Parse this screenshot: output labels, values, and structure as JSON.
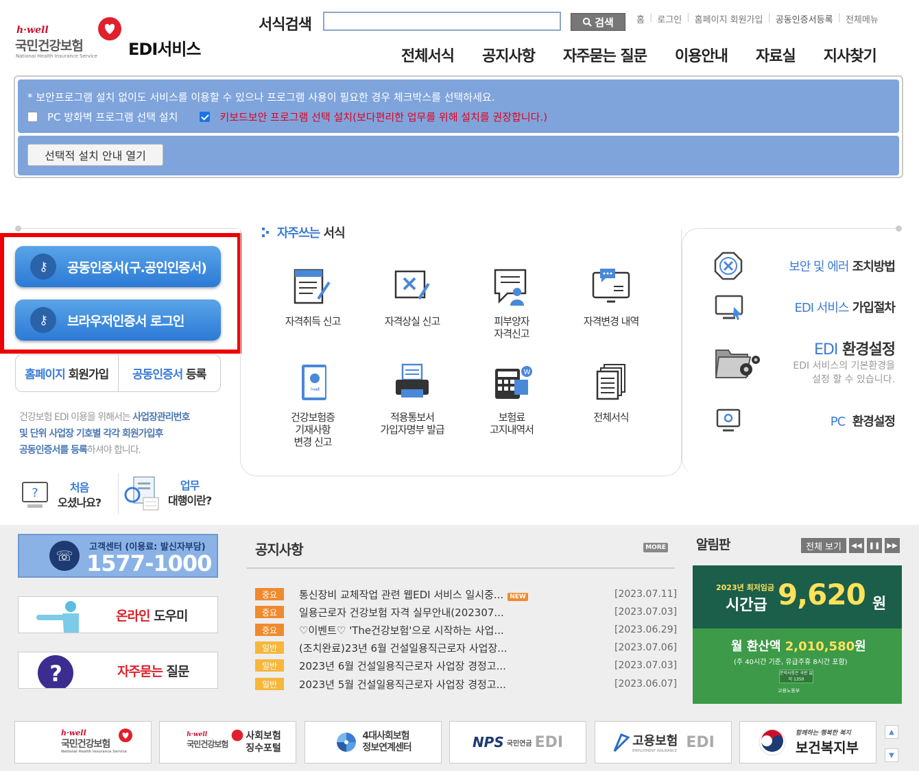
{
  "header": {
    "logo_hwell": "h·well",
    "logo_name": "국민건강보험",
    "logo_en": "National Health Insurance Service",
    "service_title": "EDI서비스",
    "search_label": "서식검색",
    "search_value": "",
    "search_button": "검색",
    "util_nav": [
      "홈",
      "로그인",
      "홈페이지 회원가입",
      "공동인증서등록",
      "전체메뉴"
    ],
    "gnb": [
      "전체서식",
      "공지사항",
      "자주묻는 질문",
      "이용안내",
      "자료실",
      "지사찾기"
    ]
  },
  "security": {
    "note": "* 보안프로그램 설치 없이도 서비스를 이용할 수 있으나 프로그램 사용이 필요한 경우 체크박스를 선택하세요.",
    "firewall_label": "PC 방화벽 프로그램 선택 설치",
    "firewall_checked": false,
    "keyboard_label": "키보드보안 프로그램 선택 설치(보다편리한 업무를 위해 설치를 권장합니다.)",
    "keyboard_checked": true,
    "open_guide_button": "선택적 설치 안내 열기"
  },
  "login": {
    "cert_button": "공동인증서(구.공인인증서)",
    "browser_button": "브라우저인증서 로그인",
    "join_highlight": "홈페이지",
    "join_rest": "회원가입",
    "register_highlight": "공동인증서",
    "register_rest": "등록",
    "desc_1": "건강보험 EDI 이용을 위해서는 ",
    "desc_1b": "사업장관리번호",
    "desc_2": "및 단위 사업장 기호별 각각 회원가입후",
    "desc_3": "공동인증서를 등록",
    "desc_3b": "하셔야 합니다.",
    "first_time_1": "처음",
    "first_time_2": "오셨나요?",
    "agency_1": "업무",
    "agency_2": "대행이란?"
  },
  "frequent_forms": {
    "title_highlight": "자주쓰는",
    "title_rest": "서식",
    "items": [
      {
        "label": "자격취득 신고"
      },
      {
        "label": "자격상실 신고"
      },
      {
        "label": "피부양자\n자격신고"
      },
      {
        "label": "자격변경 내역"
      },
      {
        "label": "건강보험증\n기재사항\n변경 신고"
      },
      {
        "label": "적용통보서\n가입자명부 발급"
      },
      {
        "label": "보험료\n고지내역서"
      },
      {
        "label": "전체서식"
      }
    ]
  },
  "right_menu": {
    "security_highlight": "보안 및 에러",
    "security_rest": "조치방법",
    "join_highlight": "EDI 서비스",
    "join_rest": "가입절차",
    "env_highlight": "EDI",
    "env_rest": "환경설정",
    "env_sub_1": "EDI 서비스의 기본환경을",
    "env_sub_2": "설정 할 수 있습니다.",
    "pc_highlight": "PC",
    "pc_rest": "환경설정"
  },
  "customer_center": {
    "label": "고객센터 (이용료: 발신자부담)",
    "number": "1577-1000"
  },
  "help": {
    "online_highlight": "온라인",
    "online_rest": "도우미",
    "faq_highlight": "자주묻는",
    "faq_rest": "질문"
  },
  "notices": {
    "title": "공지사항",
    "more": "MORE",
    "items": [
      {
        "badge": "중요",
        "type": "imp",
        "title": "통신장비 교체작업 관련 웹EDI 서비스 일시중...",
        "new": "NEW",
        "date": "[2023.07.11]"
      },
      {
        "badge": "중요",
        "type": "imp",
        "title": "일용근로자 건강보험 자격 실무안내(202307...",
        "new": "",
        "date": "[2023.07.03]"
      },
      {
        "badge": "중요",
        "type": "imp",
        "title": "♡이벤트♡ 'The건강보험'으로 시작하는 사업...",
        "new": "",
        "date": "[2023.06.29]"
      },
      {
        "badge": "일반",
        "type": "gen",
        "title": "(조치완료)23년 6월 건설일용직근로자 사업장...",
        "new": "",
        "date": "[2023.07.06]"
      },
      {
        "badge": "일반",
        "type": "gen",
        "title": "2023년 6월 건설일용직근로자 사업장 경정고...",
        "new": "",
        "date": "[2023.07.03]"
      },
      {
        "badge": "일반",
        "type": "gen",
        "title": "2023년 5월 건설일용직근로자 사업장 경정고...",
        "new": "",
        "date": "[2023.06.07]"
      }
    ]
  },
  "board": {
    "title": "알림판",
    "view_all": "전체 보기",
    "banner_year": "2023년 최저임금",
    "banner_hourly": "시간급",
    "banner_wage": "9,620",
    "banner_won": "원",
    "banner_month_label": "월 환산액 ",
    "banner_month_value": "2,010,580",
    "banner_month_won": "원",
    "banner_note": "(주 40시간 기준, 유급주휴 8시간 포함)",
    "banner_stamp": "문의사항은 국번 없이 1350",
    "banner_ministry": "고용노동부"
  },
  "footer_links": {
    "nhis_hwell": "h·well",
    "nhis_name": "국민건강보험",
    "nhis_en": "National Health Insurance Service",
    "portal_hwell": "h·well",
    "portal_name": "국민건강보험",
    "portal_text_1": "사회보험",
    "portal_text_2": "징수포털",
    "info_1": "4대사회보험",
    "info_2": "정보연계센터",
    "nps_text": "NPS",
    "nps_sub": "국민연금",
    "nps_edi": "EDI",
    "employ_text": "고용보험",
    "employ_sub": "EMPLOYMENT INSURANCE",
    "employ_edi": "EDI",
    "mohw_slogan": "함께하는 행복한 복지",
    "mohw_name": "보건복지부"
  },
  "colors": {
    "brand_red": "#c8102e",
    "accent_blue": "#3a7bd5",
    "security_blue": "#7fa4dc",
    "highlight_red_box": "#ee0000"
  }
}
